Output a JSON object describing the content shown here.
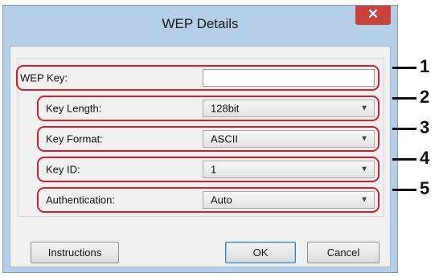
{
  "dialog": {
    "title": "WEP Details",
    "close_glyph": "✕"
  },
  "fields": [
    {
      "label": "WEP Key:",
      "value": "",
      "type": "text"
    },
    {
      "label": "Key Length:",
      "value": "128bit",
      "type": "select"
    },
    {
      "label": "Key Format:",
      "value": "ASCII",
      "type": "select"
    },
    {
      "label": "Key ID:",
      "value": "1",
      "type": "select"
    },
    {
      "label": "Authentication:",
      "value": "Auto",
      "type": "select"
    }
  ],
  "callouts": [
    "1",
    "2",
    "3",
    "4",
    "5"
  ],
  "buttons": {
    "instructions": "Instructions",
    "ok": "OK",
    "cancel": "Cancel"
  },
  "icons": {
    "dropdown": "chevron-down-icon",
    "close": "close-icon"
  },
  "colors": {
    "highlight": "#d4202d",
    "close_button": "#c8433b",
    "frame": "#b6cfe8"
  }
}
